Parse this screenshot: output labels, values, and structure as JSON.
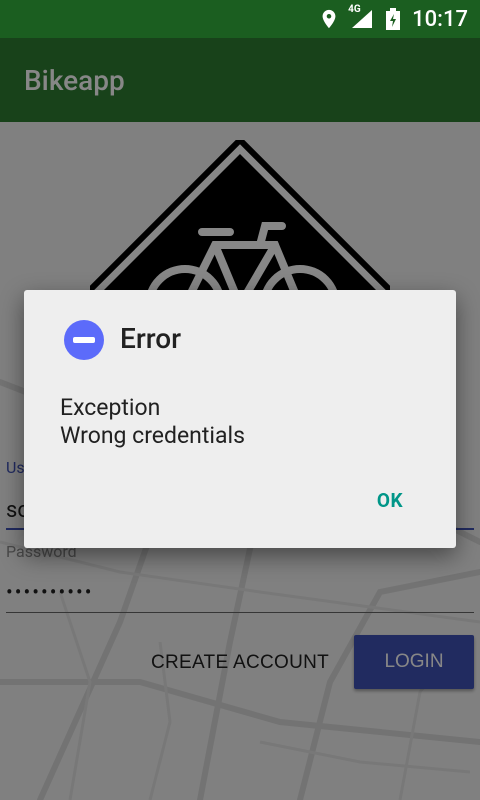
{
  "status_bar": {
    "time": "10:17",
    "network": "4G",
    "icons": [
      "location-icon",
      "signal-icon",
      "battery-icon"
    ]
  },
  "app_bar": {
    "title": "Bikeapp"
  },
  "login_form": {
    "username_label": "Us",
    "username_value": "sc",
    "password_label": "Password",
    "password_value": "••••••••••",
    "create_account_label": "CREATE ACCOUNT",
    "login_label": "LOGIN"
  },
  "dialog": {
    "title": "Error",
    "message_line1": "Exception",
    "message_line2": "Wrong credentials",
    "ok_label": "OK",
    "icon": "minus-circle-icon"
  },
  "colors": {
    "status_bar": "#1b5e20",
    "app_bar": "#2e7d32",
    "accent": "#3f51b5",
    "dialog_button": "#009688",
    "error_icon": "#5c6bfa"
  }
}
